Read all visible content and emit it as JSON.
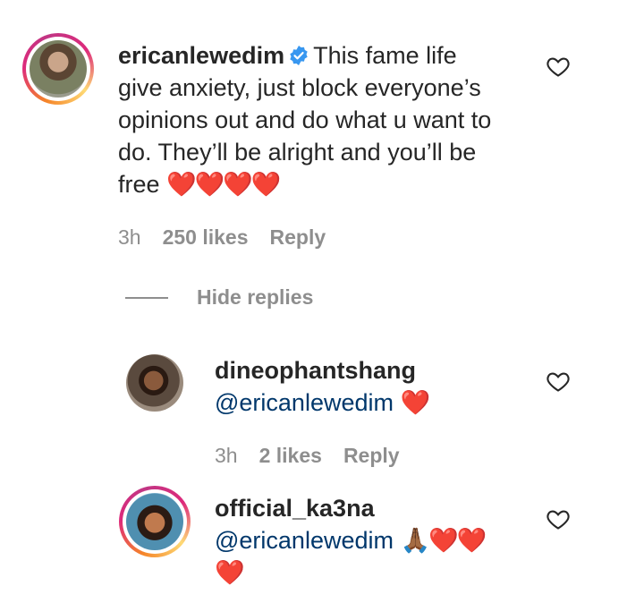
{
  "comment1": {
    "username": "ericanlewedim",
    "verified": true,
    "text_line1": "This fame life",
    "text_line2": "give anxiety, just block everyone’s",
    "text_line3": "opinions out and do what u want to",
    "text_line4": "do. They’ll be alright and you’ll be",
    "text_line5": "free",
    "emoji": "❤️❤️❤️❤️",
    "time": "3h",
    "likes": "250 likes",
    "reply_label": "Reply"
  },
  "replies_toggle": {
    "label": "Hide replies"
  },
  "reply1": {
    "username": "dineophantshang",
    "mention": "@ericanlewedim",
    "emoji": "❤️",
    "time": "3h",
    "likes": "2 likes",
    "reply_label": "Reply"
  },
  "reply2": {
    "username": "official_ka3na",
    "mention": "@ericanlewedim",
    "emoji_line1": "🙏🏾❤️❤️",
    "emoji_line2": "❤️"
  },
  "colors": {
    "text": "#262626",
    "secondary": "#8e8e8e",
    "mention": "#00376b",
    "verified": "#3897f0",
    "heart": "#e0141e"
  }
}
